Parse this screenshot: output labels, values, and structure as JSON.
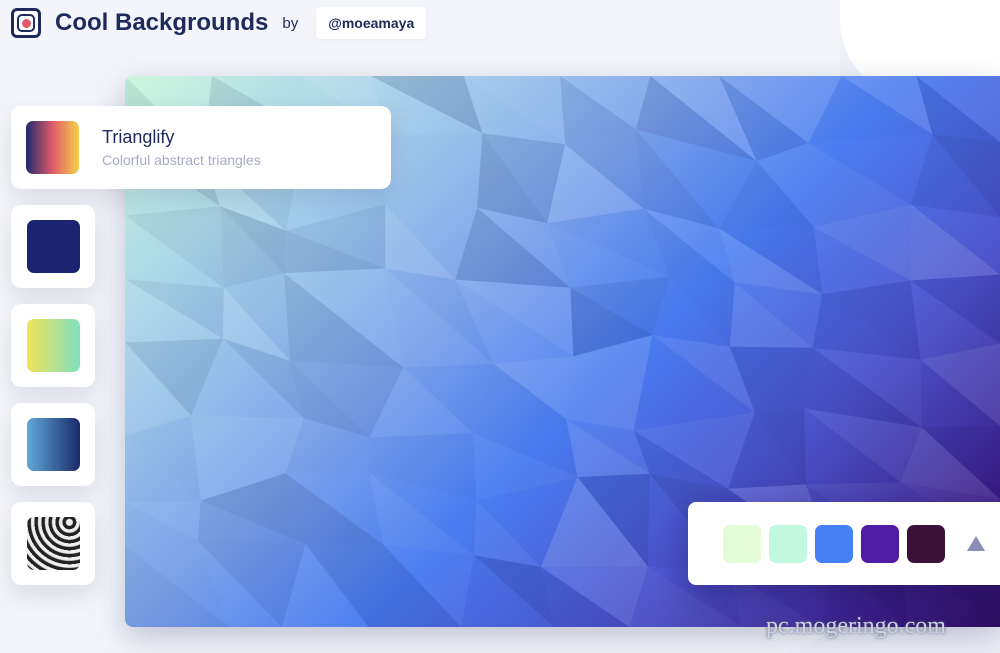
{
  "header": {
    "title": "Cool Backgrounds",
    "by": "by",
    "author": "@moeamaya",
    "logo_icon": "target-square-icon"
  },
  "selected": {
    "title": "Trianglify",
    "subtitle": "Colorful abstract triangles",
    "thumb_gradient": [
      "#1f2a6c",
      "#e05a6a",
      "#f5d04a"
    ]
  },
  "options": [
    {
      "name": "solid-navy",
      "colors": [
        "#1b2470",
        "#1b2470"
      ]
    },
    {
      "name": "yellow-mint",
      "colors": [
        "#f2e35a",
        "#7fe0c0"
      ]
    },
    {
      "name": "blue-navy",
      "colors": [
        "#5fa8d8",
        "#1a2a6a"
      ]
    },
    {
      "name": "mono-wave",
      "colors": [
        "#f0f0f0",
        "#111111"
      ]
    }
  ],
  "palette": {
    "colors": [
      "#e3fcd7",
      "#c2f8e0",
      "#4680f7",
      "#4f1ca6",
      "#3c1138"
    ],
    "shuffle_icon": "triangle-icon"
  },
  "watermark": "pc.mogeringo.com"
}
